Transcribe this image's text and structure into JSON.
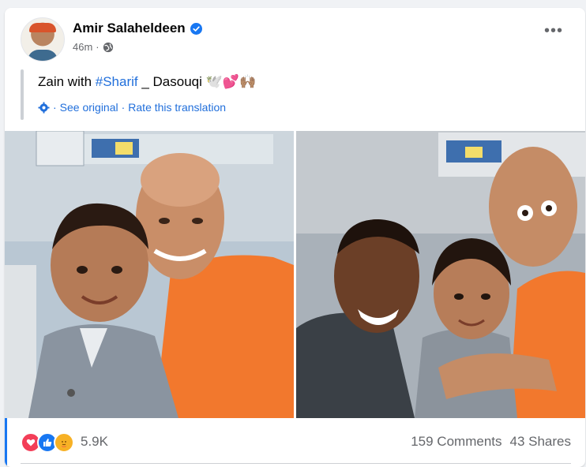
{
  "post": {
    "author": "Amir Salaheldeen",
    "time": "46m",
    "separator": "·",
    "text_prefix": "Zain with ",
    "hashtag": "#Sharif",
    "text_suffix": " _ Dasouqi 🕊️💕🙌🏽",
    "see_original": "See original",
    "rate_translation": "Rate this translation",
    "translate_sep": "·"
  },
  "engagement": {
    "reactions": "5.9K",
    "comments": "159 Comments",
    "shares": "43 Shares"
  },
  "icons": {
    "more": "more-options-icon",
    "verified": "verified-badge-icon",
    "privacy": "globe-icon",
    "translate": "gear-icon"
  },
  "colors": {
    "accent": "#1877f2",
    "link": "#216fdb",
    "love": "#f33e58",
    "care": "#f7b125",
    "shirt_orange": "#f2782d"
  }
}
